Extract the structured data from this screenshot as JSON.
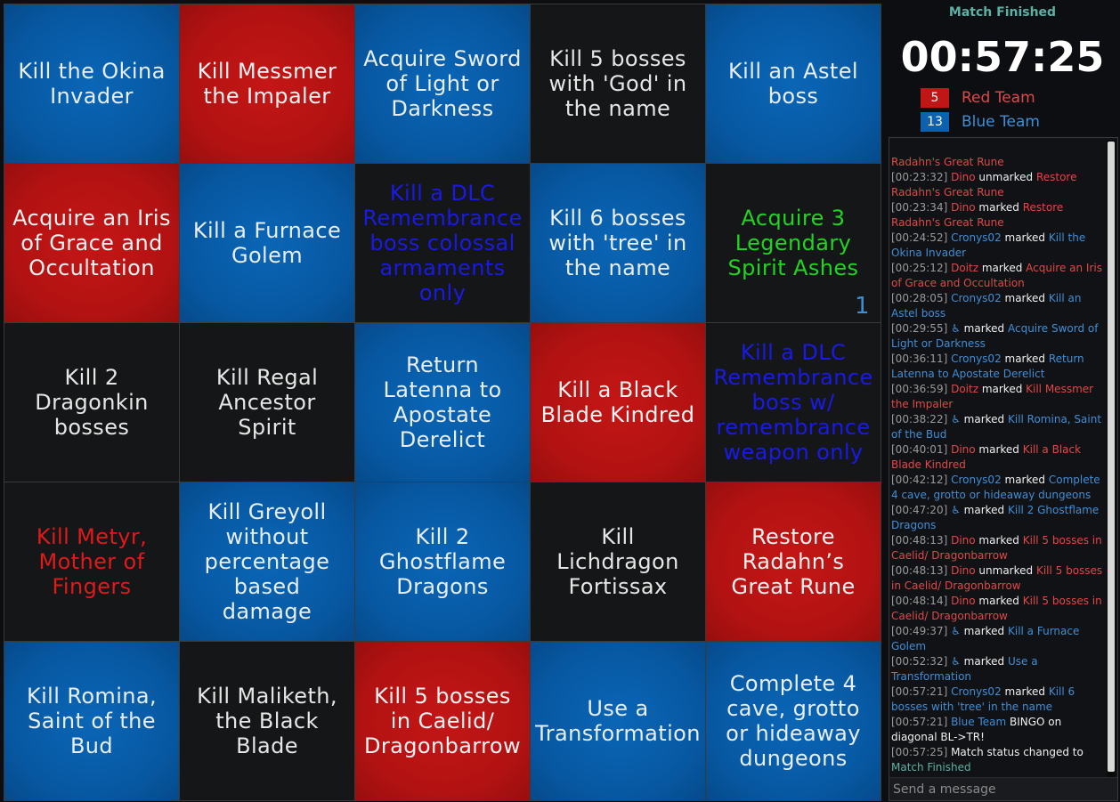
{
  "board": {
    "cells": [
      {
        "text": "Kill the Okina Invader",
        "bg": "blue",
        "color": "#e8eef5"
      },
      {
        "text": "Kill Messmer the Impaler",
        "bg": "red",
        "color": "#f2f2f2"
      },
      {
        "text": "Acquire Sword of Light or Darkness",
        "bg": "blue",
        "color": "#e8eef5"
      },
      {
        "text": "Kill 5 bosses with 'God' in the name",
        "bg": "black",
        "color": "#e6e6e6"
      },
      {
        "text": "Kill an Astel boss",
        "bg": "blue",
        "color": "#e8eef5"
      },
      {
        "text": "Acquire an Iris of Grace and Occultation",
        "bg": "red",
        "color": "#f2f2f2"
      },
      {
        "text": "Kill a Furnace Golem",
        "bg": "blue",
        "color": "#e8eef5"
      },
      {
        "text": "Kill a DLC Remembrance boss colossal armaments only",
        "bg": "black",
        "color": "#1a1ae6"
      },
      {
        "text": "Kill 6 bosses with 'tree' in the name",
        "bg": "blue",
        "color": "#e8eef5"
      },
      {
        "text": "Acquire 3 Legendary Spirit Ashes",
        "bg": "black",
        "color": "#21d421",
        "counter": "1"
      },
      {
        "text": "Kill 2 Dragonkin bosses",
        "bg": "black",
        "color": "#e6e6e6"
      },
      {
        "text": "Kill Regal Ancestor Spirit",
        "bg": "black",
        "color": "#e6e6e6"
      },
      {
        "text": "Return Latenna to Apostate Derelict",
        "bg": "blue",
        "color": "#e8eef5"
      },
      {
        "text": "Kill a Black Blade Kindred",
        "bg": "red",
        "color": "#f2f2f2"
      },
      {
        "text": "Kill a DLC Remembrance boss w/ remembrance weapon only",
        "bg": "black",
        "color": "#1a1ae6"
      },
      {
        "text": "Kill Metyr, Mother of Fingers",
        "bg": "black",
        "color": "#e01a1a"
      },
      {
        "text": "Kill Greyoll without percentage based damage",
        "bg": "blue",
        "color": "#e8eef5"
      },
      {
        "text": "Kill 2 Ghostflame Dragons",
        "bg": "blue",
        "color": "#e8eef5"
      },
      {
        "text": "Kill Lichdragon Fortissax",
        "bg": "black",
        "color": "#e6e6e6"
      },
      {
        "text": "Restore Radahn’s Great Rune",
        "bg": "red",
        "color": "#f2f2f2"
      },
      {
        "text": "Kill Romina, Saint of the Bud",
        "bg": "blue",
        "color": "#e8eef5"
      },
      {
        "text": "Kill Maliketh, the Black Blade",
        "bg": "black",
        "color": "#e6e6e6"
      },
      {
        "text": "Kill 5 bosses in Caelid/ Dragonbarrow",
        "bg": "red",
        "color": "#f2f2f2"
      },
      {
        "text": "Use a Transformation",
        "bg": "blue",
        "color": "#e8eef5"
      },
      {
        "text": "Complete 4 cave, grotto or hideaway dungeons",
        "bg": "blue",
        "color": "#e8eef5"
      }
    ]
  },
  "sidebar": {
    "status": "Match Finished",
    "timer": "00:57:25",
    "teams": [
      {
        "score": "5",
        "name": "Red Team"
      },
      {
        "score": "13",
        "name": "Blue Team"
      }
    ]
  },
  "chat": {
    "placeholder": "Send a message",
    "log": [
      [
        [
          "r",
          "Radahn's Great Rune"
        ]
      ],
      [
        [
          "ts",
          "[00:23:32] "
        ],
        [
          "r",
          "Dino"
        ],
        [
          "w",
          " unmarked "
        ],
        [
          "r",
          "Restore Radahn's Great Rune"
        ]
      ],
      [
        [
          "ts",
          "[00:23:34] "
        ],
        [
          "r",
          "Dino"
        ],
        [
          "w",
          " marked "
        ],
        [
          "r",
          "Restore Radahn's Great Rune"
        ]
      ],
      [
        [
          "ts",
          "[00:24:52] "
        ],
        [
          "b",
          "Cronys02"
        ],
        [
          "w",
          " marked "
        ],
        [
          "b",
          "Kill the Okina Invader"
        ]
      ],
      [
        [
          "ts",
          "[00:25:12] "
        ],
        [
          "r",
          "Doitz"
        ],
        [
          "w",
          " marked "
        ],
        [
          "r",
          "Acquire an Iris of Grace and Occultation"
        ]
      ],
      [
        [
          "ts",
          "[00:28:05] "
        ],
        [
          "b",
          "Cronys02"
        ],
        [
          "w",
          " marked "
        ],
        [
          "b",
          "Kill an Astel boss"
        ]
      ],
      [
        [
          "ts",
          "[00:29:55] "
        ],
        [
          "b",
          "♿"
        ],
        [
          "w",
          " marked "
        ],
        [
          "b",
          "Acquire Sword of Light or Darkness"
        ]
      ],
      [
        [
          "ts",
          "[00:36:11] "
        ],
        [
          "b",
          "Cronys02"
        ],
        [
          "w",
          " marked "
        ],
        [
          "b",
          "Return Latenna to Apostate Derelict"
        ]
      ],
      [
        [
          "ts",
          "[00:36:59] "
        ],
        [
          "r",
          "Doitz"
        ],
        [
          "w",
          " marked "
        ],
        [
          "r",
          "Kill Messmer the Impaler"
        ]
      ],
      [
        [
          "ts",
          "[00:38:22] "
        ],
        [
          "b",
          "♿"
        ],
        [
          "w",
          " marked "
        ],
        [
          "b",
          "Kill Romina, Saint of the Bud"
        ]
      ],
      [
        [
          "ts",
          "[00:40:01] "
        ],
        [
          "r",
          "Dino"
        ],
        [
          "w",
          " marked "
        ],
        [
          "r",
          "Kill a Black Blade Kindred"
        ]
      ],
      [
        [
          "ts",
          "[00:42:12] "
        ],
        [
          "b",
          "Cronys02"
        ],
        [
          "w",
          " marked "
        ],
        [
          "b",
          "Complete 4 cave, grotto or hideaway dungeons"
        ]
      ],
      [
        [
          "ts",
          "[00:47:20] "
        ],
        [
          "b",
          "♿"
        ],
        [
          "w",
          " marked "
        ],
        [
          "b",
          "Kill 2 Ghostflame Dragons"
        ]
      ],
      [
        [
          "ts",
          "[00:48:13] "
        ],
        [
          "r",
          "Dino"
        ],
        [
          "w",
          " marked "
        ],
        [
          "r",
          "Kill 5 bosses in Caelid/ Dragonbarrow"
        ]
      ],
      [
        [
          "ts",
          "[00:48:13] "
        ],
        [
          "r",
          "Dino"
        ],
        [
          "w",
          " unmarked "
        ],
        [
          "r",
          "Kill 5 bosses in Caelid/ Dragonbarrow"
        ]
      ],
      [
        [
          "ts",
          "[00:48:14] "
        ],
        [
          "r",
          "Dino"
        ],
        [
          "w",
          " marked "
        ],
        [
          "r",
          "Kill 5 bosses in Caelid/ Dragonbarrow"
        ]
      ],
      [
        [
          "ts",
          "[00:49:37] "
        ],
        [
          "b",
          "♿"
        ],
        [
          "w",
          " marked "
        ],
        [
          "b",
          "Kill a Furnace Golem"
        ]
      ],
      [
        [
          "ts",
          "[00:52:32] "
        ],
        [
          "b",
          "♿"
        ],
        [
          "w",
          " marked "
        ],
        [
          "b",
          "Use a Transformation"
        ]
      ],
      [
        [
          "ts",
          "[00:57:21] "
        ],
        [
          "b",
          "Cronys02"
        ],
        [
          "w",
          " marked "
        ],
        [
          "b",
          "Kill 6 bosses with 'tree' in the name"
        ]
      ],
      [
        [
          "ts",
          "[00:57:21] "
        ],
        [
          "b",
          "Blue Team"
        ],
        [
          "w",
          " BINGO on diagonal BL->TR!"
        ]
      ],
      [
        [
          "ts",
          "[00:57:25] "
        ],
        [
          "w",
          "Match status changed to "
        ],
        [
          "g",
          "Match Finished"
        ]
      ]
    ]
  }
}
